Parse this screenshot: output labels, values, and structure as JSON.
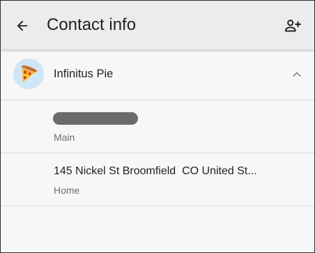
{
  "header": {
    "title": "Contact info",
    "back_icon": "arrow-left-icon",
    "add_icon": "person-add-icon"
  },
  "contact": {
    "name": "Infinitus Pie",
    "avatar_icon": "pizza-slice-icon",
    "expand_icon": "chevron-up-icon",
    "avatar_color": "#cfe6f7"
  },
  "phone": {
    "label": "Main"
  },
  "address": {
    "value": "145 Nickel St Broomfield  CO United St...",
    "label": "Home"
  }
}
